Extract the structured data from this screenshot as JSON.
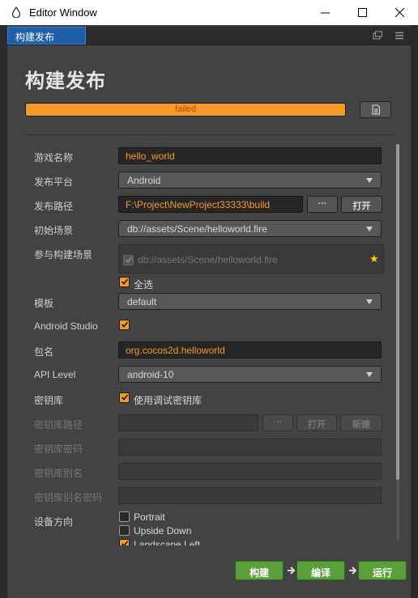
{
  "window": {
    "title": "Editor Window"
  },
  "tab": {
    "label": "构建发布"
  },
  "page": {
    "title": "构建发布"
  },
  "progress": {
    "text": "failed",
    "value": 1.0,
    "color": "#f59a2a"
  },
  "form": {
    "game_name": {
      "label": "游戏名称",
      "value": "hello_world"
    },
    "platform": {
      "label": "发布平台",
      "value": "Android"
    },
    "build_path": {
      "label": "发布路径",
      "value": "F:\\Project\\NewProject33333\\build",
      "browse_label": "···",
      "open_label": "打开"
    },
    "start_scene": {
      "label": "初始场景",
      "value": "db://assets/Scene/helloworld.fire"
    },
    "included_scenes": {
      "label": "参与构建场景",
      "scene": "db://assets/Scene/helloworld.fire",
      "select_all": "全选"
    },
    "template": {
      "label": "模板",
      "value": "default"
    },
    "android_studio": {
      "label": "Android Studio",
      "checked": true
    },
    "package_name": {
      "label": "包名",
      "value": "org.cocos2d.helloworld"
    },
    "api_level": {
      "label": "API Level",
      "value": "android-10"
    },
    "keystore": {
      "label": "密钥库",
      "option": "使用调试密钥库",
      "checked": true
    },
    "keystore_path": {
      "label": "密钥库路径",
      "browse_label": "···",
      "open_label": "打开",
      "new_label": "新建"
    },
    "keystore_password": {
      "label": "密钥库密码"
    },
    "keystore_alias": {
      "label": "密钥库别名"
    },
    "keystore_alias_password": {
      "label": "密钥库别名密码"
    },
    "orientation": {
      "label": "设备方向",
      "options": [
        "Portrait",
        "Upside Down",
        "Landscape Left"
      ],
      "checked": [
        false,
        false,
        true
      ]
    }
  },
  "actions": {
    "build": "构建",
    "compile": "编译",
    "run": "运行"
  },
  "colors": {
    "accent": "#f59a2a",
    "tab_active": "#1f5fa8",
    "action_green": "#5aa03a"
  }
}
